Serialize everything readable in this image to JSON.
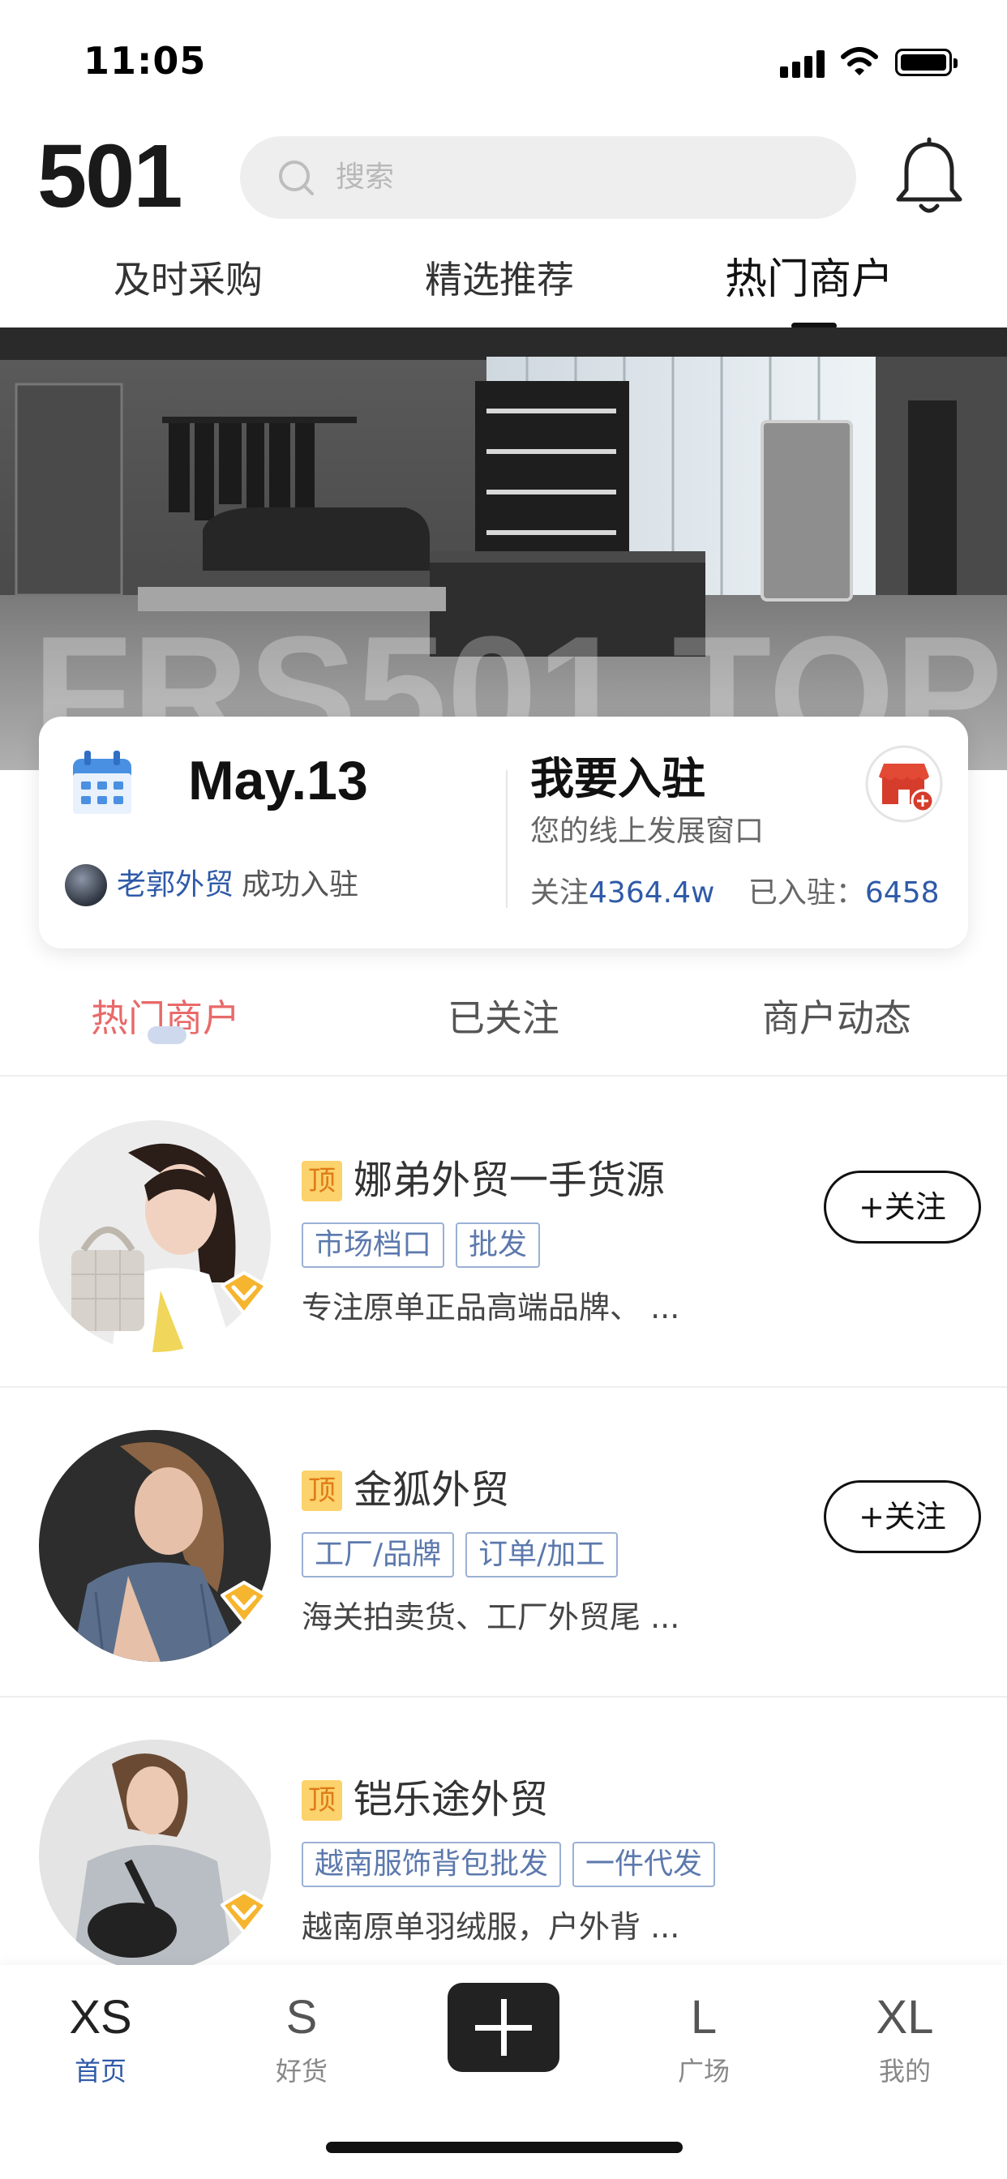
{
  "status": {
    "time": "11:05"
  },
  "header": {
    "logo": "501",
    "search_placeholder": "搜索"
  },
  "top_tabs": [
    {
      "label": "及时采购"
    },
    {
      "label": "精选推荐"
    },
    {
      "label": "热门商户",
      "active": true
    }
  ],
  "banner": {
    "overlay_text": "FRS501 TOP"
  },
  "info_card": {
    "date": "May.13",
    "joined_name": "老郭外贸",
    "joined_action": "成功入驻",
    "title": "我要入驻",
    "subtitle": "您的线上发展窗口",
    "followers_label": "关注",
    "followers_value": "4364.4w",
    "joined_label": "已入驻：",
    "joined_value": "6458"
  },
  "section_tabs": [
    {
      "label": "热门商户",
      "active": true
    },
    {
      "label": "已关注"
    },
    {
      "label": "商户动态"
    }
  ],
  "merchants": [
    {
      "badge": "顶",
      "name": "娜弟外贸一手货源",
      "tags": [
        "市场档口",
        "批发"
      ],
      "desc": "专注原单正品高端品牌、 ...",
      "follow_label": "+关注"
    },
    {
      "badge": "顶",
      "name": "金狐外贸",
      "tags": [
        "工厂/品牌",
        "订单/加工"
      ],
      "desc": "海关拍卖货、工厂外贸尾 ...",
      "follow_label": "+关注"
    },
    {
      "badge": "顶",
      "name": "铠乐途外贸",
      "tags": [
        "越南服饰背包批发",
        "一件代发"
      ],
      "desc": "越南原单羽绒服，户外背 ..."
    }
  ],
  "bottom_nav": [
    {
      "size": "XS",
      "label": "首页",
      "active": true
    },
    {
      "size": "S",
      "label": "好货"
    },
    {
      "size": "L",
      "label": "广场"
    },
    {
      "size": "XL",
      "label": "我的"
    }
  ],
  "colors": {
    "accent_blue": "#2f5aa8",
    "active_red": "#e86a6a",
    "badge_yellow": "#fbd26b"
  }
}
